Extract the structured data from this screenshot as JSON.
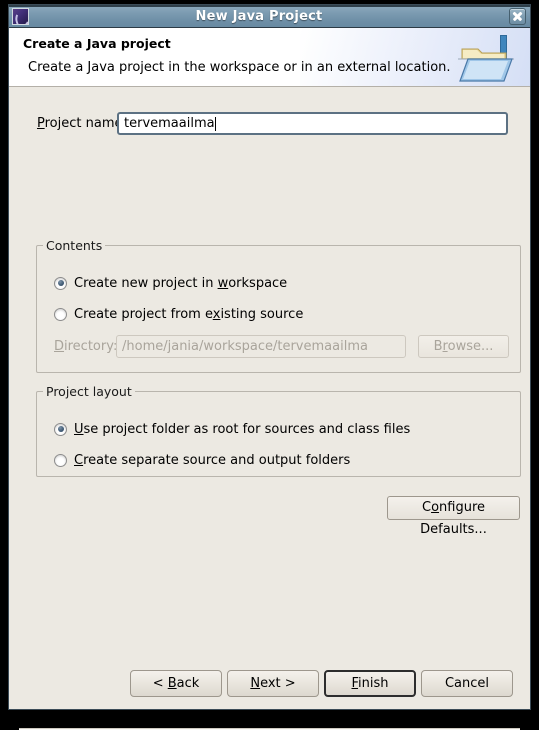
{
  "window": {
    "title": "New Java Project",
    "app_icon": "eclipse-icon",
    "close_label": "close-icon"
  },
  "header": {
    "title": "Create a Java project",
    "description": "Create a Java project in the workspace or in an external location.",
    "icon": "java-project-folder-icon"
  },
  "project_name": {
    "label_pre": "",
    "label_mnemonic": "P",
    "label_post": "roject name:",
    "value": "tervemaailma",
    "placeholder": ""
  },
  "contents": {
    "legend": "Contents",
    "options": [
      {
        "pre": "Create new project in ",
        "mnemonic": "w",
        "post": "orkspace",
        "checked": true
      },
      {
        "pre": "Create project from e",
        "mnemonic": "x",
        "post": "isting source",
        "checked": false
      }
    ],
    "directory": {
      "label_pre": "",
      "label_mnemonic": "D",
      "label_post": "irectory:",
      "value": "/home/jania/workspace/tervemaailma",
      "enabled": false
    },
    "browse": {
      "pre": "B",
      "mnemonic": "r",
      "post": "owse...",
      "enabled": false
    }
  },
  "project_layout": {
    "legend": "Project layout",
    "options": [
      {
        "pre": "",
        "mnemonic": "U",
        "post": "se project folder as root for sources and class files",
        "checked": true
      },
      {
        "pre": "",
        "mnemonic": "C",
        "post": "reate separate source and output folders",
        "checked": false
      }
    ]
  },
  "configure_defaults": {
    "pre": "C",
    "mnemonic": "o",
    "post": "nfigure Defaults..."
  },
  "buttons": [
    {
      "pre": "< ",
      "mnemonic": "B",
      "post": "ack",
      "default": false,
      "name": "back-button"
    },
    {
      "pre": "",
      "mnemonic": "N",
      "post": "ext >",
      "default": false,
      "name": "next-button"
    },
    {
      "pre": "",
      "mnemonic": "F",
      "post": "inish",
      "default": true,
      "name": "finish-button"
    },
    {
      "pre": "Cancel",
      "mnemonic": "",
      "post": "",
      "default": false,
      "name": "cancel-button"
    }
  ],
  "colors": {
    "titlebar": "#7a9ab0",
    "dialog_bg": "#ece9e2",
    "header_bg": "#ffffff",
    "focus_border": "#5c7183",
    "disabled_text": "#a9a49b"
  }
}
